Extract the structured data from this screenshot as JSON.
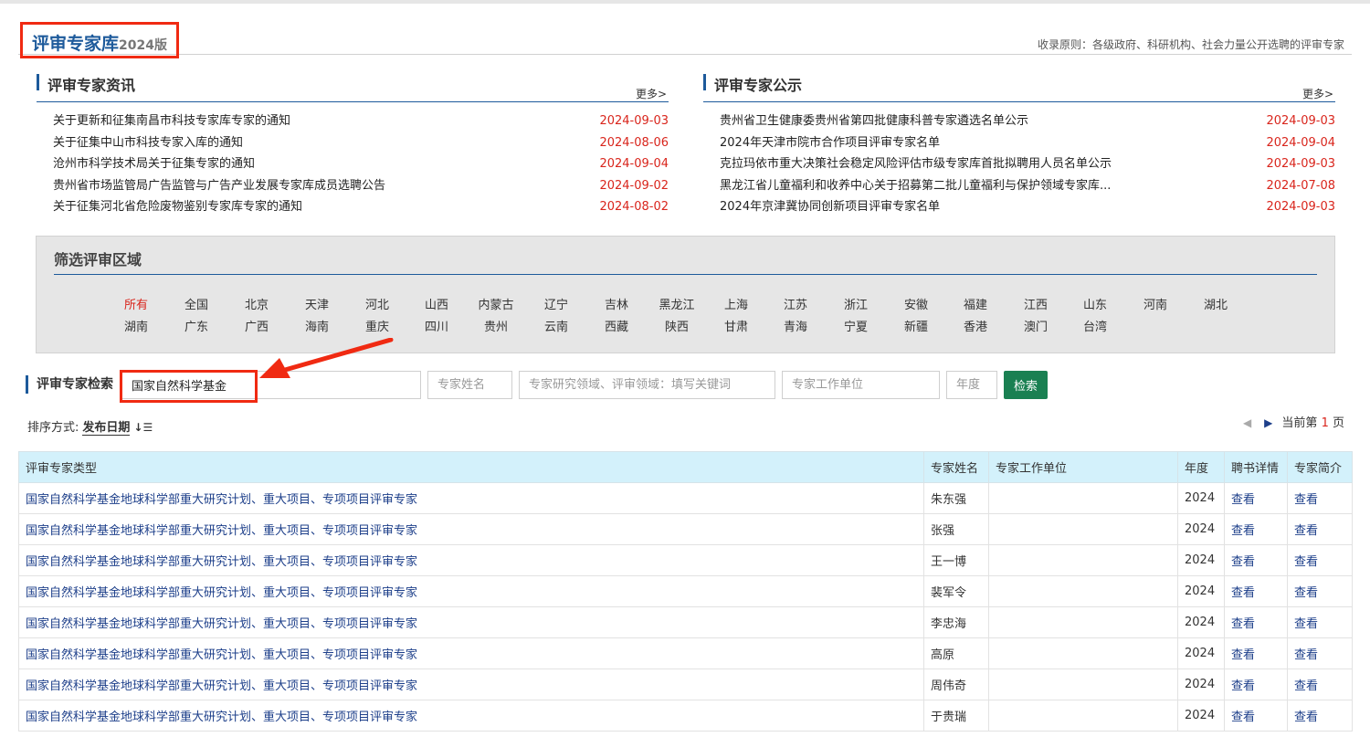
{
  "header": {
    "title": "评审专家库",
    "version": "2024版",
    "principle": "收录原则：各级政府、科研机构、社会力量公开选聘的评审专家"
  },
  "news_left": {
    "title": "评审专家资讯",
    "more": "更多>",
    "items": [
      {
        "title": "关于更新和征集南昌市科技专家库专家的通知",
        "date": "2024-09-03"
      },
      {
        "title": "关于征集中山市科技专家入库的通知",
        "date": "2024-08-06"
      },
      {
        "title": "沧州市科学技术局关于征集专家的通知",
        "date": "2024-09-04"
      },
      {
        "title": "贵州省市场监管局广告监管与广告产业发展专家库成员选聘公告",
        "date": "2024-09-02"
      },
      {
        "title": "关于征集河北省危险废物鉴别专家库专家的通知",
        "date": "2024-08-02"
      }
    ]
  },
  "news_right": {
    "title": "评审专家公示",
    "more": "更多>",
    "items": [
      {
        "title": "贵州省卫生健康委贵州省第四批健康科普专家遴选名单公示",
        "date": "2024-09-03"
      },
      {
        "title": "2024年天津市院市合作项目评审专家名单",
        "date": "2024-09-04"
      },
      {
        "title": "克拉玛依市重大决策社会稳定风险评估市级专家库首批拟聘用人员名单公示",
        "date": "2024-09-03"
      },
      {
        "title": "黑龙江省儿童福利和收养中心关于招募第二批儿童福利与保护领域专家库...",
        "date": "2024-07-08"
      },
      {
        "title": "2024年京津冀协同创新项目评审专家名单",
        "date": "2024-09-03"
      }
    ]
  },
  "filter": {
    "title": "筛选评审区域",
    "row1": [
      "所有",
      "全国",
      "北京",
      "天津",
      "河北",
      "山西",
      "内蒙古",
      "辽宁",
      "吉林",
      "黑龙江",
      "上海",
      "江苏",
      "浙江",
      "安徽",
      "福建",
      "江西",
      "山东",
      "河南",
      "湖北"
    ],
    "row2": [
      "湖南",
      "广东",
      "广西",
      "海南",
      "重庆",
      "四川",
      "贵州",
      "云南",
      "西藏",
      "陕西",
      "甘肃",
      "青海",
      "宁夏",
      "新疆",
      "香港",
      "澳门",
      "台湾"
    ],
    "selected": "所有"
  },
  "search": {
    "label": "评审专家检索",
    "type_value": "国家自然科学基金",
    "name_placeholder": "专家姓名",
    "field_placeholder": "专家研究领域、评审领域：填写关键词",
    "unit_placeholder": "专家工作单位",
    "year_placeholder": "年度",
    "button": "检索"
  },
  "sort": {
    "label": "排序方式:",
    "key": "发布日期",
    "icon": "↓☰"
  },
  "pager": {
    "prev": "◀",
    "next": "▶",
    "prefix": "当前第",
    "page": "1",
    "suffix": "页"
  },
  "table": {
    "headers": [
      "评审专家类型",
      "专家姓名",
      "专家工作单位",
      "年度",
      "聘书详情",
      "专家简介"
    ],
    "rows": [
      {
        "type": "国家自然科学基金地球科学部重大研究计划、重大项目、专项项目评审专家",
        "name": "朱东强",
        "unit": "",
        "year": "2024",
        "cert": "查看",
        "intro": "查看"
      },
      {
        "type": "国家自然科学基金地球科学部重大研究计划、重大项目、专项项目评审专家",
        "name": "张强",
        "unit": "",
        "year": "2024",
        "cert": "查看",
        "intro": "查看"
      },
      {
        "type": "国家自然科学基金地球科学部重大研究计划、重大项目、专项项目评审专家",
        "name": "王一博",
        "unit": "",
        "year": "2024",
        "cert": "查看",
        "intro": "查看"
      },
      {
        "type": "国家自然科学基金地球科学部重大研究计划、重大项目、专项项目评审专家",
        "name": "裴军令",
        "unit": "",
        "year": "2024",
        "cert": "查看",
        "intro": "查看"
      },
      {
        "type": "国家自然科学基金地球科学部重大研究计划、重大项目、专项项目评审专家",
        "name": "李忠海",
        "unit": "",
        "year": "2024",
        "cert": "查看",
        "intro": "查看"
      },
      {
        "type": "国家自然科学基金地球科学部重大研究计划、重大项目、专项项目评审专家",
        "name": "高原",
        "unit": "",
        "year": "2024",
        "cert": "查看",
        "intro": "查看"
      },
      {
        "type": "国家自然科学基金地球科学部重大研究计划、重大项目、专项项目评审专家",
        "name": "周伟奇",
        "unit": "",
        "year": "2024",
        "cert": "查看",
        "intro": "查看"
      },
      {
        "type": "国家自然科学基金地球科学部重大研究计划、重大项目、专项项目评审专家",
        "name": "于贵瑞",
        "unit": "",
        "year": "2024",
        "cert": "查看",
        "intro": "查看"
      }
    ]
  },
  "colors": {
    "accent_blue": "#1d5a9b",
    "date_red": "#d9251c",
    "annotation_red": "#f02a12",
    "button_green": "#1a8052",
    "table_header_bg": "#d3f1fb"
  }
}
